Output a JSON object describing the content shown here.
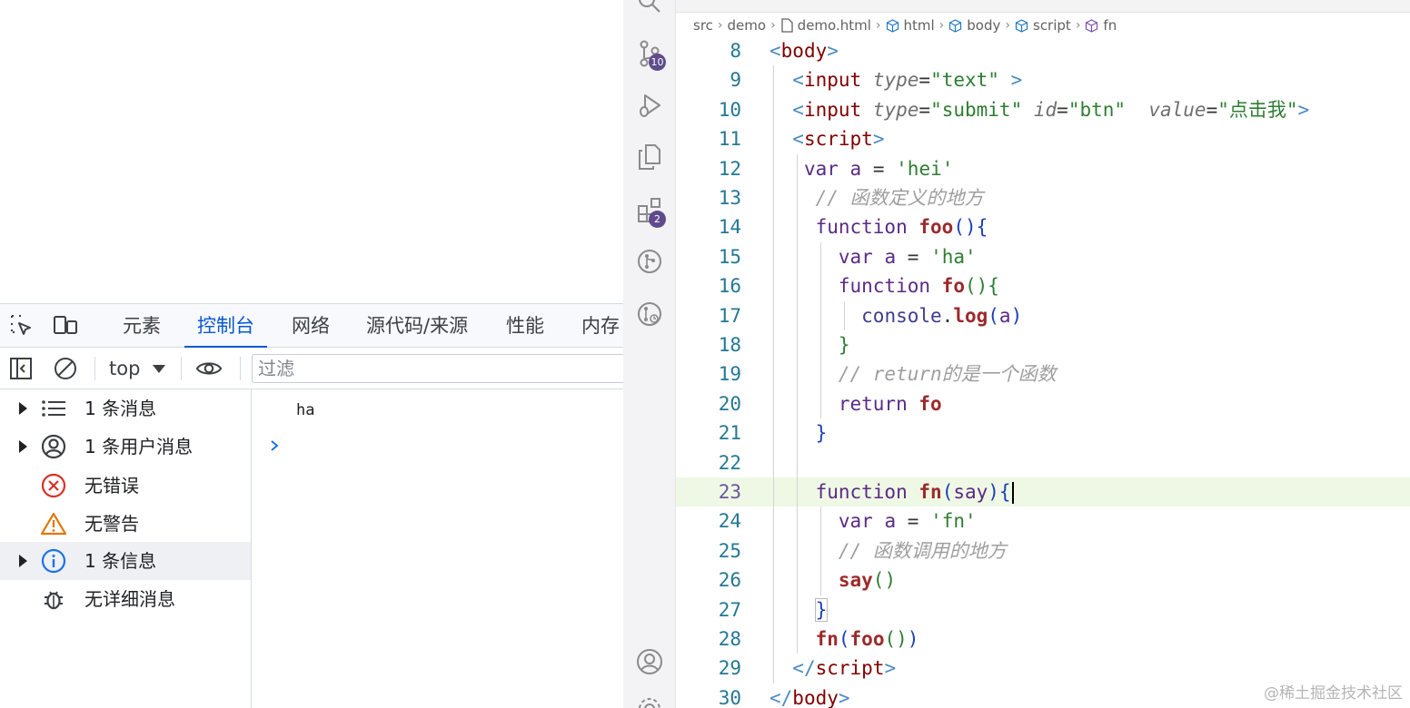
{
  "devtools": {
    "tabs": [
      "元素",
      "控制台",
      "网络",
      "源代码/来源",
      "性能",
      "内存"
    ],
    "active_tab": "控制台",
    "context_selector": "top",
    "filter_placeholder": "过滤",
    "sidebar": [
      {
        "label": "1 条消息",
        "icon": "list-icon",
        "expandable": true
      },
      {
        "label": "1 条用户消息",
        "icon": "user-icon",
        "expandable": true
      },
      {
        "label": "无错误",
        "icon": "error-icon",
        "expandable": false
      },
      {
        "label": "无警告",
        "icon": "warning-icon",
        "expandable": false
      },
      {
        "label": "1 条信息",
        "icon": "info-icon",
        "expandable": true,
        "selected": true
      },
      {
        "label": "无详细消息",
        "icon": "bug-icon",
        "expandable": false
      }
    ],
    "console_output": [
      "ha"
    ],
    "colors": {
      "accent": "#0b57d0",
      "error": "#d93025",
      "warning": "#e37400",
      "info": "#1a73e8"
    }
  },
  "vscode": {
    "activity_badges": {
      "source_control": "10",
      "extensions": "2"
    },
    "breadcrumb": [
      "src",
      "demo",
      "demo.html",
      "html",
      "body",
      "script",
      "fn"
    ],
    "current_line": "23",
    "line_numbers": [
      "8",
      "9",
      "10",
      "11",
      "12",
      "13",
      "14",
      "15",
      "16",
      "17",
      "18",
      "19",
      "20",
      "21",
      "22",
      "23",
      "24",
      "25",
      "26",
      "27",
      "28",
      "29",
      "30"
    ]
  },
  "watermark": "@稀土掘金技术社区"
}
